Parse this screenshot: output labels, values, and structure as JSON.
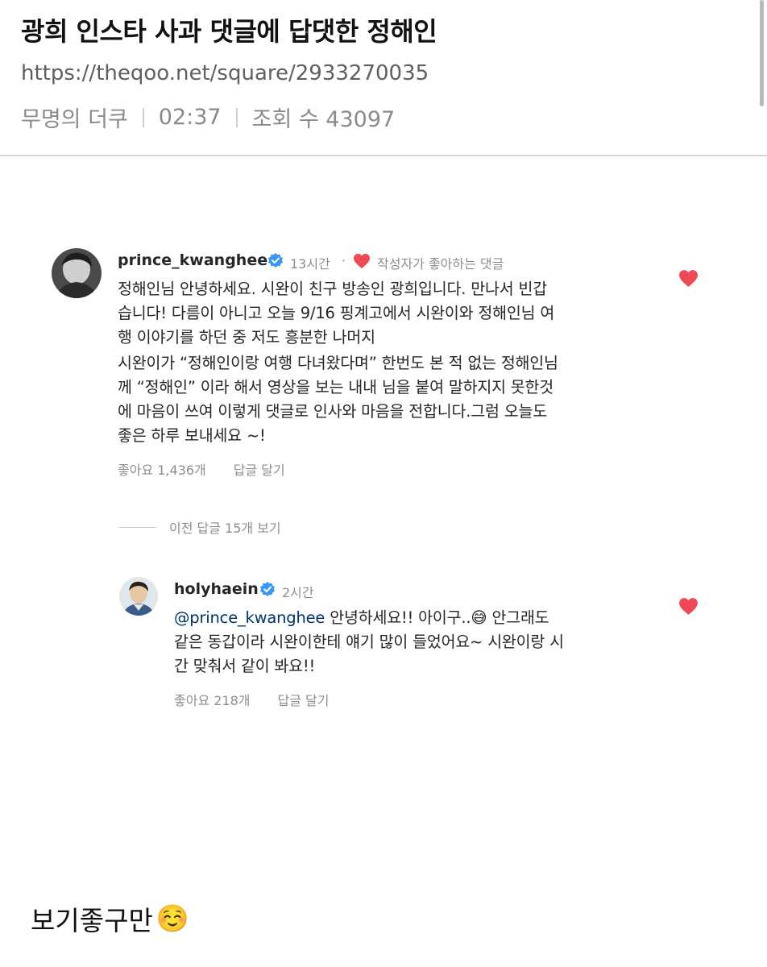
{
  "post": {
    "title": "광희 인스타 사과 댓글에 답댓한 정해인",
    "url": "https://theqoo.net/square/2933270035",
    "author": "무명의 더쿠",
    "time": "02:37",
    "views_label": "조회 수 43097"
  },
  "comment": {
    "username": "prince_kwanghee",
    "time": "13시간",
    "dot": "·",
    "liked_by_author": "작성자가 좋아하는 댓글",
    "paragraph1_lines": [
      "정해인님 안녕하세요. 시완이 친구 방송인 광희입니다. 만나서 빈갑",
      "습니다! 다름이 아니고 오늘 9/16 핑계고에서 시완이와 정해인님 여",
      "행 이야기를 하던 중 저도 흥분한 나머지"
    ],
    "paragraph2_lines": [
      "시완이가 “정해인이랑 여행 다녀왔다며” 한번도 본 적 없는 정해인님",
      "께 “정해인” 이라 해서 영상을 보는 내내 님을 붙여 말하지지 못한것",
      "에 마음이 쓰여 이렇게 댓글로 인사와 마음을 전합니다.그럼 오늘도",
      "좋은 하루 보내세요 ~!"
    ],
    "likes": "좋아요 1,436개",
    "reply_action": "답글 달기"
  },
  "view_previous": "이전 답글 15개 보기",
  "reply": {
    "username": "holyhaein",
    "time": "2시간",
    "mention": "@prince_kwanghee",
    "line1_rest": " 안녕하세요!! 아이구..",
    "line1_emoji": "😅",
    "line1_tail": " 안그래도",
    "line2": "같은 동갑이라 시완이한테 얘기 많이 들었어요~ 시완이랑 시",
    "line3": "간 맞춰서 같이 봐요!!",
    "likes": "좋아요 218개",
    "reply_action": "답글 달기"
  },
  "caption": {
    "text": "보기좋구만",
    "emoji": "☺️"
  },
  "icons": {
    "verified": "verified-badge-icon",
    "heart": "heart-icon"
  },
  "colors": {
    "heart": "#ed4956",
    "verified": "#3897f0",
    "mention": "#003569",
    "meta": "#8e8e8e"
  }
}
